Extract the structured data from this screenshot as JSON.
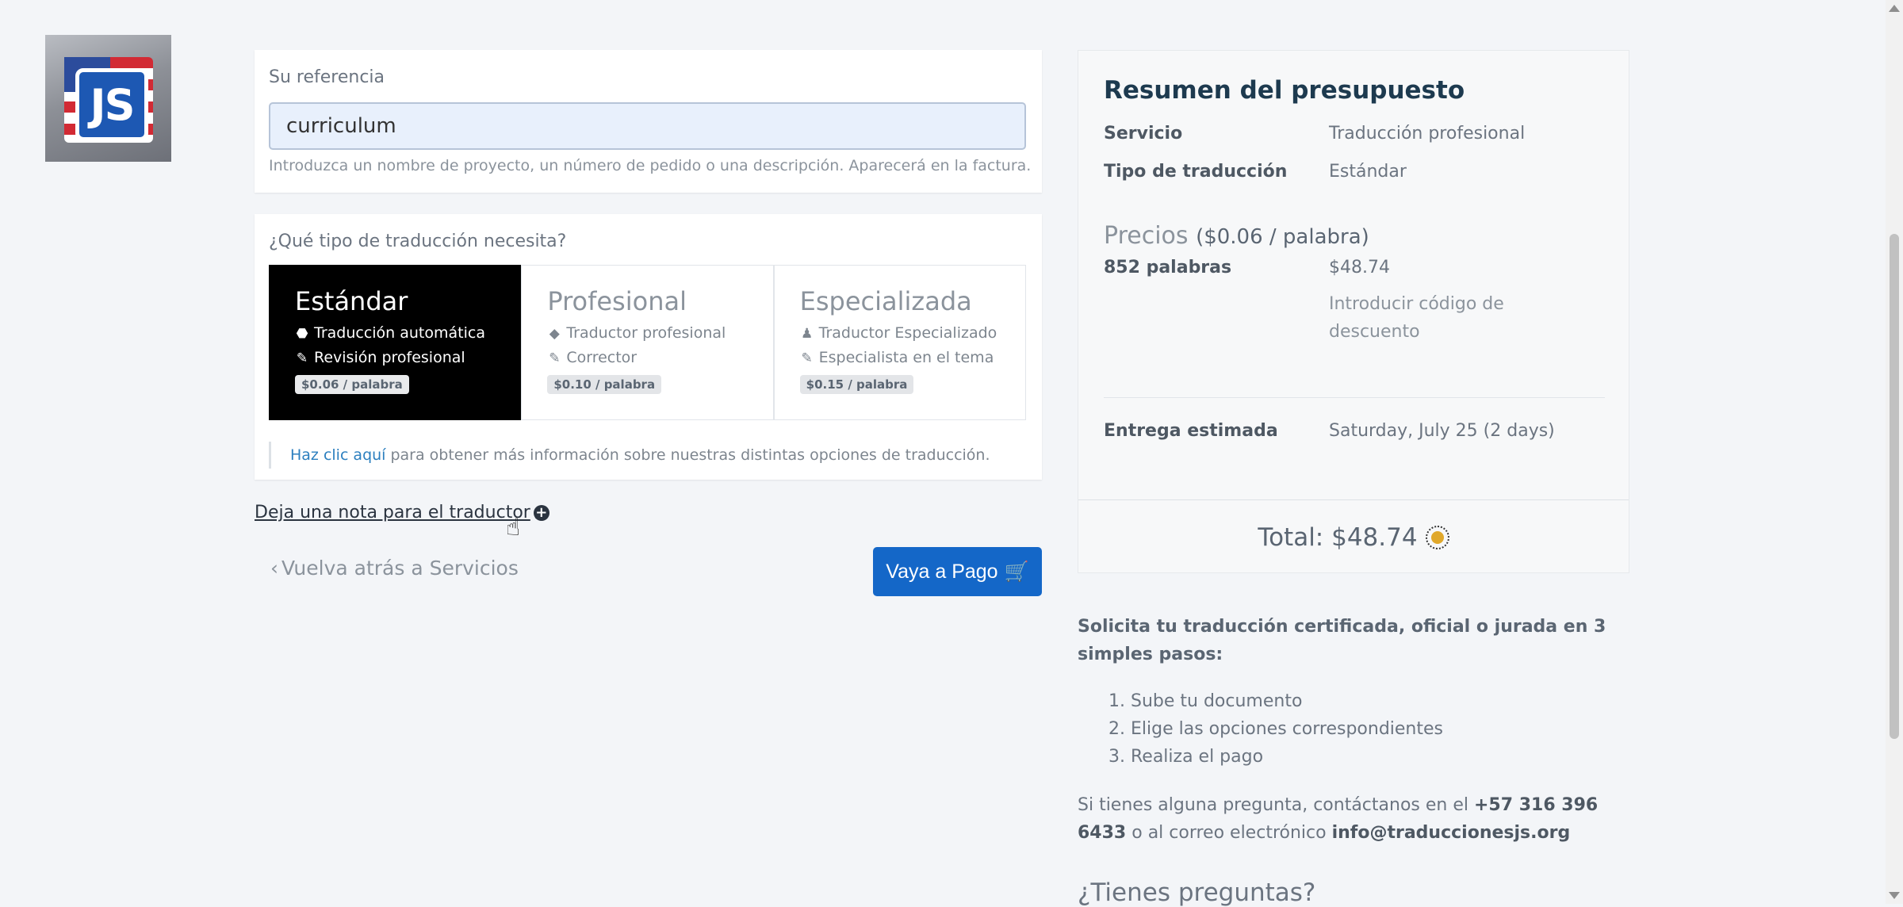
{
  "logo": {
    "text": "JS"
  },
  "reference": {
    "label": "Su referencia",
    "value": "curriculum",
    "help": "Introduzca un nombre de proyecto, un número de pedido o una descripción. Aparecerá en la factura."
  },
  "translation_type": {
    "label": "¿Qué tipo de traducción necesita?",
    "options": [
      {
        "title": "Estándar",
        "line1": "Traducción automática",
        "line2": "Revisión profesional",
        "price": "$0.06 / palabra",
        "active": true
      },
      {
        "title": "Profesional",
        "line1": "Traductor profesional",
        "line2": "Corrector",
        "price": "$0.10 / palabra",
        "active": false
      },
      {
        "title": "Especializada",
        "line1": "Traductor Especializado",
        "line2": "Especialista en el tema",
        "price": "$0.15 / palabra",
        "active": false
      }
    ],
    "info_link": "Haz clic aquí",
    "info_text": "para obtener más información sobre nuestras distintas opciones de traducción."
  },
  "note_link": "Deja una nota para el traductor",
  "back_link": "Vuelva atrás a Servicios",
  "pay_button": "Vaya a Pago",
  "summary": {
    "title": "Resumen del presupuesto",
    "service_label": "Servicio",
    "service_value": "Traducción profesional",
    "type_label": "Tipo de traducción",
    "type_value": "Estándar",
    "prices_label": "Precios",
    "prices_per": "($0.06 / palabra)",
    "words_label": "852 palabras",
    "words_value": "$48.74",
    "discount": "Introducir código de descuento",
    "delivery_label": "Entrega estimada",
    "delivery_value": "Saturday, July 25 (2 days)",
    "total": "Total: $48.74"
  },
  "steps": {
    "title": "Solicita tu traducción certificada, oficial o jurada en 3 simples pasos:",
    "items": [
      "1. Sube tu documento",
      "2. Elige las opciones correspondientes",
      "3. Realiza el pago"
    ]
  },
  "contact": {
    "prefix": "Si tienes alguna pregunta, contáctanos en el",
    "phone": "+57 316 396 6433",
    "middle": "o al correo electrónico",
    "email": "info@traduccionesjs.org"
  },
  "faq_heading": "¿Tienes preguntas?"
}
